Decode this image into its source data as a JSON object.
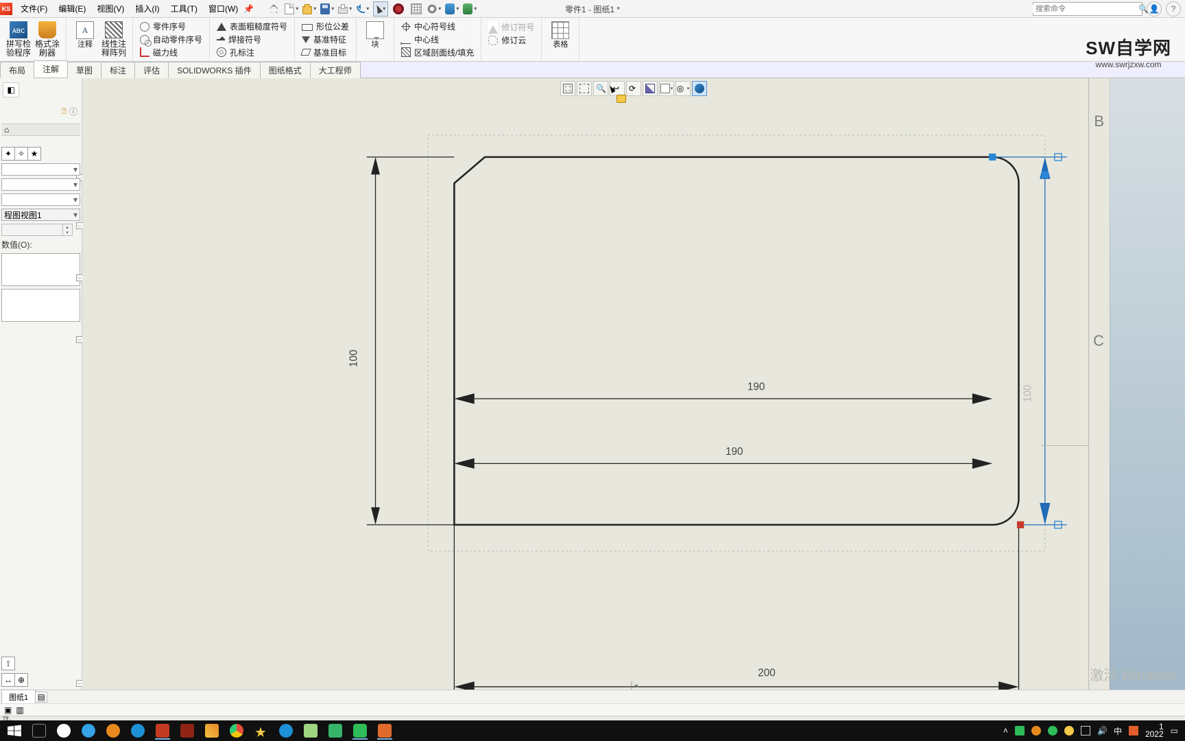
{
  "app": {
    "logo_text": "KS",
    "doc_title": "零件1 - 图纸1 *"
  },
  "menus": {
    "file": "文件(F)",
    "edit": "编辑(E)",
    "view": "视图(V)",
    "insert": "插入(I)",
    "tools": "工具(T)",
    "window": "窗口(W)"
  },
  "search": {
    "placeholder": "搜索命令",
    "glyph": "🔍"
  },
  "header_icons": {
    "user": "👤",
    "help": "?"
  },
  "ribbon": {
    "smart_spell": {
      "l1": "拼写检",
      "l2": "验程序"
    },
    "format_painter": {
      "l1": "格式涂",
      "l2": "刷器"
    },
    "note": "注释",
    "pattern": {
      "l1": "线性注",
      "l2": "释阵列"
    },
    "big_A": "A",
    "balloon": "零件序号",
    "auto_balloon": "自动零件序号",
    "magnetic": "磁力线",
    "rough": "表面粗糙度符号",
    "weld": "焊接符号",
    "hole": "孔标注",
    "gtol": "形位公差",
    "dfs": "基准特征",
    "dtg": "基准目标",
    "block": "块",
    "cmark": "中心符号线",
    "cline": "中心线",
    "hatch": "区域剖面线/填充",
    "rev_sym": "修订符号",
    "rev_cloud": "修订云",
    "table": "表格"
  },
  "tabs": {
    "layout": "布局",
    "annot": "注解",
    "sketch": "草图",
    "dims": "标注",
    "eval": "评估",
    "addin": "SOLIDWORKS 插件",
    "sheetfmt": "图纸格式",
    "dagong": "大工程师"
  },
  "side": {
    "origin_btn": "⌂",
    "view_name": "程图视图1",
    "value_label": "数值(O):",
    "collapse_glyph": "⌄"
  },
  "hud": {
    "tips": {
      "zfit": "全屏",
      "zarea": "区域",
      "zio": "缩放",
      "prev": "上一",
      "rot": "旋转",
      "app": "外观",
      "sec": "剖切",
      "disp": "显示",
      "hide": "隐藏",
      "view3d": "3D"
    }
  },
  "drawing": {
    "dim_190a": "190",
    "dim_190b": "190",
    "dim_200a": "200",
    "dim_200b": "200",
    "dim_100": "100",
    "zoneB": "B",
    "zoneC": "C"
  },
  "activate": "激活 Windows",
  "watermark": {
    "line1": "SW自学网",
    "line2": "www.swrjzxw.com"
  },
  "sheet_tabs": {
    "sheet1": "图纸1"
  },
  "status": "性.",
  "tray": {
    "ime": "中",
    "time": "1",
    "date": "2022"
  }
}
